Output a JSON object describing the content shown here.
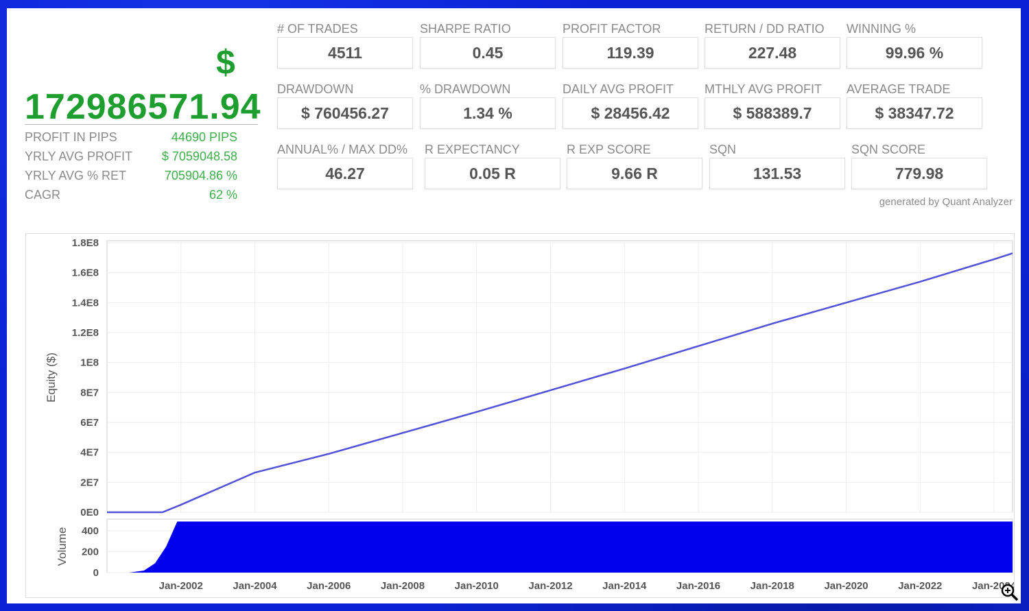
{
  "summary": {
    "currency": "$",
    "total_profit": "172986571.94",
    "rows": [
      {
        "label": "PROFIT IN PIPS",
        "value": "44690 PIPS"
      },
      {
        "label": "YRLY AVG PROFIT",
        "value": "$ 7059048.58"
      },
      {
        "label": "YRLY AVG % RET",
        "value": "705904.86 %"
      },
      {
        "label": "CAGR",
        "value": "62 %"
      }
    ]
  },
  "metrics": [
    [
      {
        "label": "# OF TRADES",
        "value": "4511"
      },
      {
        "label": "SHARPE RATIO",
        "value": "0.45"
      },
      {
        "label": "PROFIT FACTOR",
        "value": "119.39"
      },
      {
        "label": "RETURN / DD RATIO",
        "value": "227.48"
      },
      {
        "label": "WINNING %",
        "value": "99.96 %"
      }
    ],
    [
      {
        "label": "DRAWDOWN",
        "value": "$ 760456.27"
      },
      {
        "label": "% DRAWDOWN",
        "value": "1.34 %"
      },
      {
        "label": "DAILY AVG PROFIT",
        "value": "$ 28456.42"
      },
      {
        "label": "MTHLY AVG PROFIT",
        "value": "$ 588389.7"
      },
      {
        "label": "AVERAGE TRADE",
        "value": "$ 38347.72"
      }
    ],
    [
      {
        "label": "ANNUAL% / MAX DD%",
        "value": "46.27"
      },
      {
        "label": "R EXPECTANCY",
        "value": "0.05 R"
      },
      {
        "label": "R EXP SCORE",
        "value": "9.66 R"
      },
      {
        "label": "SQN",
        "value": "131.53"
      },
      {
        "label": "SQN SCORE",
        "value": "779.98"
      }
    ]
  ],
  "generated_by": "generated by Quant Analyzer",
  "chart_data": [
    {
      "type": "line",
      "ylabel": "Equity ($)",
      "ylim": [
        0,
        180000000
      ],
      "yticks": [
        "0E0",
        "2E7",
        "4E7",
        "6E7",
        "8E7",
        "1E8",
        "1.2E8",
        "1.4E8",
        "1.6E8",
        "1.8E8"
      ],
      "x": [
        2000,
        2001.5,
        2002,
        2004,
        2006,
        2008,
        2010,
        2012,
        2014,
        2016,
        2018,
        2020,
        2022,
        2024,
        2024.5
      ],
      "y": [
        0,
        0,
        5000000,
        26500000,
        39000000,
        53000000,
        67000000,
        81500000,
        96000000,
        111000000,
        126000000,
        140000000,
        154000000,
        169000000,
        173000000
      ],
      "color": "#5050d8"
    },
    {
      "type": "area",
      "ylabel": "Volume",
      "ylim": [
        0,
        500
      ],
      "yticks": [
        "0",
        "200",
        "400"
      ],
      "x": [
        2000,
        2000.6,
        2001,
        2001.3,
        2001.6,
        2001.9,
        2024.5
      ],
      "y": [
        0,
        0,
        20,
        90,
        250,
        490,
        490
      ],
      "color": "#0000ee",
      "xticks": [
        "Jan-2002",
        "Jan-2004",
        "Jan-2006",
        "Jan-2008",
        "Jan-2010",
        "Jan-2012",
        "Jan-2014",
        "Jan-2016",
        "Jan-2018",
        "Jan-2020",
        "Jan-2022",
        "Jan-2024"
      ],
      "xlim": [
        2000,
        2024.5
      ]
    }
  ]
}
